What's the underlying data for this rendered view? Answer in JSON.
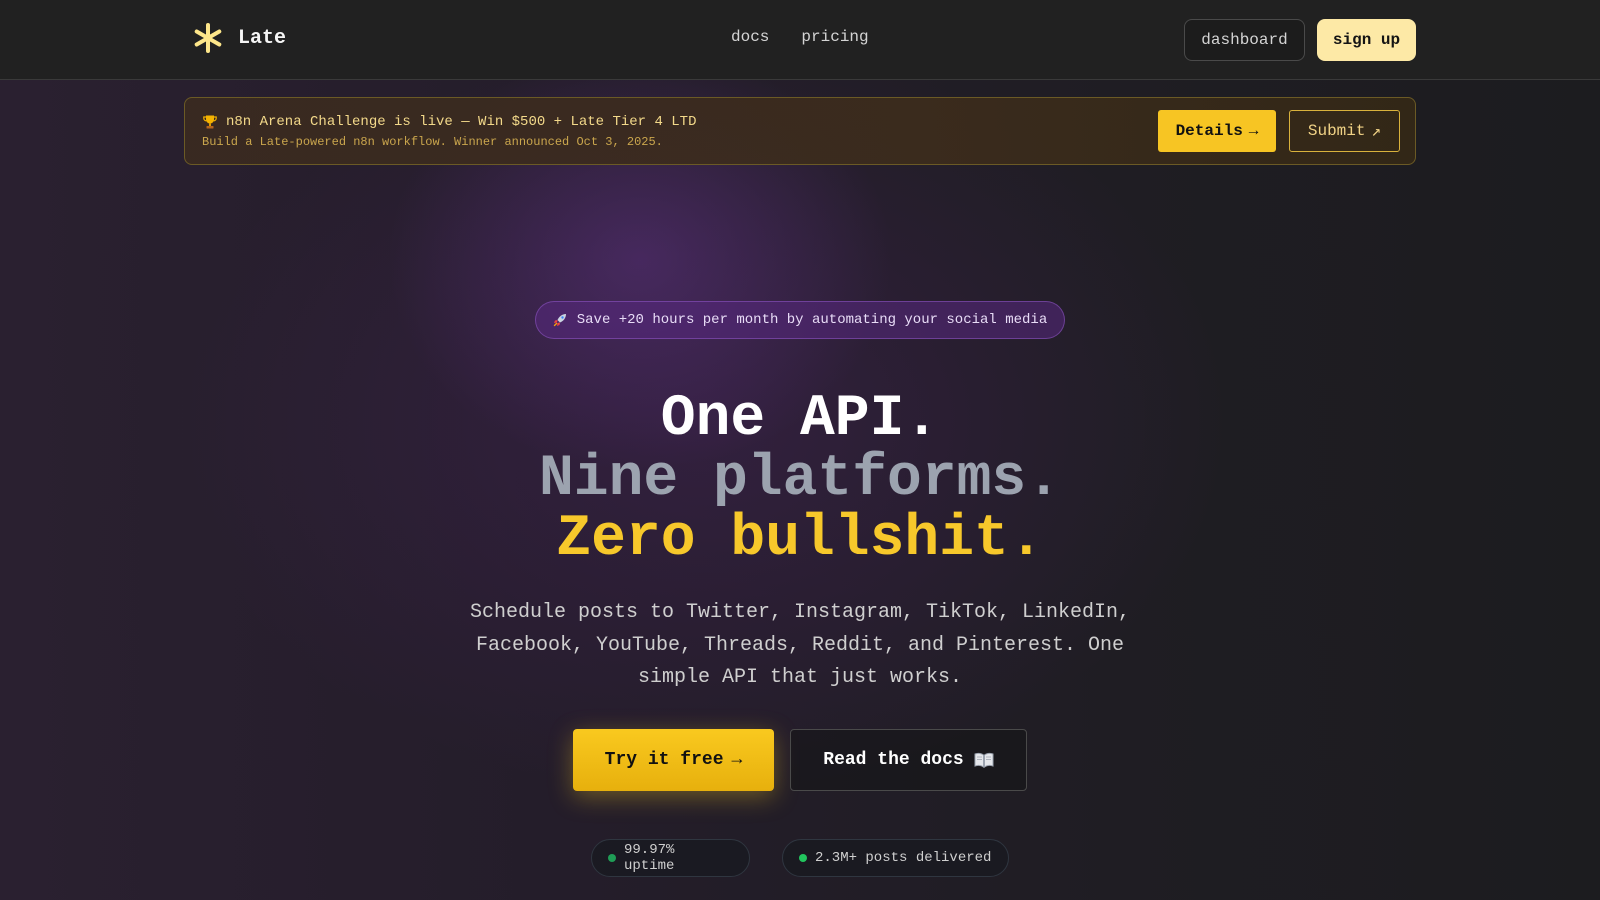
{
  "navbar": {
    "brand": "Late",
    "links": [
      {
        "label": "docs"
      },
      {
        "label": "pricing"
      }
    ],
    "dashboard_label": "dashboard",
    "signup_label": "sign up"
  },
  "banner": {
    "icon": "trophy-icon",
    "title": "n8n Arena Challenge is live — Win $500 + Late Tier 4 LTD",
    "subtitle": "Build a Late-powered n8n workflow. Winner announced Oct 3, 2025.",
    "details_label": "Details",
    "details_arrow": "→",
    "submit_label": "Submit",
    "submit_arrow": "↗"
  },
  "hero": {
    "pill_icon": "rocket-icon",
    "pill_text": "Save +20 hours per month by automating your social media",
    "headline": {
      "line1": "One API.",
      "line2": "Nine platforms.",
      "line3": "Zero bullshit."
    },
    "description": "Schedule posts to Twitter, Instagram, TikTok, LinkedIn, Facebook, YouTube, Threads, Reddit, and Pinterest. One simple API that just works.",
    "cta_primary": "Try it free",
    "cta_primary_arrow": "→",
    "cta_secondary": "Read the docs",
    "cta_secondary_icon": "book-icon"
  },
  "stats": [
    {
      "text": "99.97% uptime"
    },
    {
      "text": "2.3M+ posts delivered"
    }
  ],
  "colors": {
    "accent": "#f7c523",
    "accent_light": "#fde9a6",
    "status_green": "#22c55e",
    "headline_gray": "#9ca3af"
  }
}
